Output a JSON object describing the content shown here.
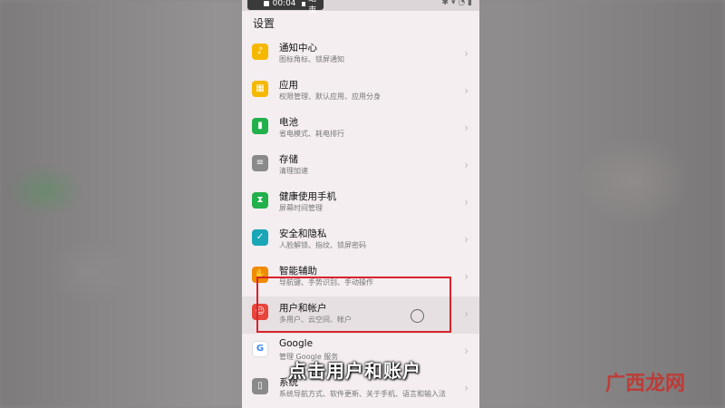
{
  "status": {
    "time": "00:04",
    "recording": "结束"
  },
  "page_title": "设置",
  "items": [
    {
      "title": "通知中心",
      "subtitle": "图标角标、锁屏通知",
      "icon": "bell-icon",
      "color": "#f5b800",
      "glyph": "♪"
    },
    {
      "title": "应用",
      "subtitle": "权限管理、默认应用、应用分身",
      "icon": "apps-icon",
      "color": "#f5b800",
      "glyph": "▦"
    },
    {
      "title": "电池",
      "subtitle": "省电模式、耗电排行",
      "icon": "battery-icon",
      "color": "#22b04b",
      "glyph": "▮"
    },
    {
      "title": "存储",
      "subtitle": "清理加速",
      "icon": "storage-icon",
      "color": "#8a8a8a",
      "glyph": "≡"
    },
    {
      "title": "健康使用手机",
      "subtitle": "屏幕时间管理",
      "icon": "hourglass-icon",
      "color": "#22b04b",
      "glyph": "⧗"
    },
    {
      "title": "安全和隐私",
      "subtitle": "人脸解锁、指纹、锁屏密码",
      "icon": "shield-icon",
      "color": "#1aa6b7",
      "glyph": "✓"
    },
    {
      "title": "智能辅助",
      "subtitle": "导航键、手势识别、手动操作",
      "icon": "assist-icon",
      "color": "#f08a00",
      "glyph": "✋"
    },
    {
      "title": "用户和帐户",
      "subtitle": "多用户、云空间、帐户",
      "icon": "user-icon",
      "color": "#e8453c",
      "glyph": "☺"
    },
    {
      "title": "Google",
      "subtitle": "管理 Google 服务",
      "icon": "google-icon",
      "color": "#ffffff",
      "glyph": "G"
    },
    {
      "title": "系统",
      "subtitle": "系统导航方式、软件更新、关于手机、语言和输入法",
      "icon": "system-icon",
      "color": "#8a8a8a",
      "glyph": "▯"
    }
  ],
  "caption": "点击用户和账户",
  "watermark": "广西龙网"
}
